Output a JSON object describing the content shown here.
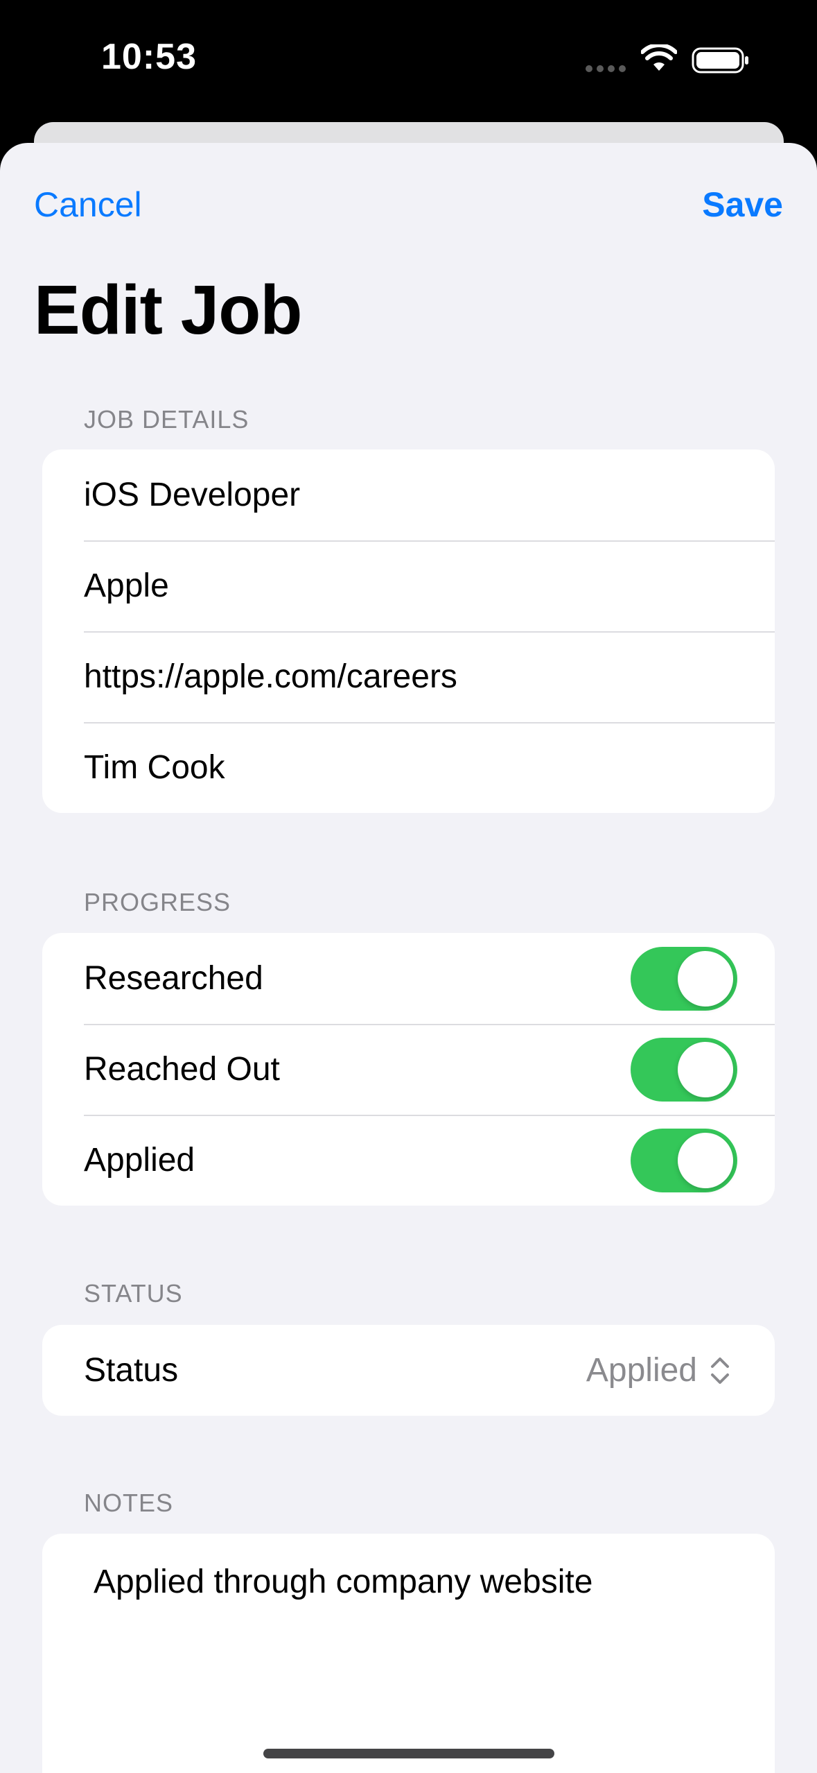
{
  "status_bar": {
    "time": "10:53",
    "wifi_icon": "wifi-icon",
    "battery_icon": "battery-icon"
  },
  "nav": {
    "cancel_label": "Cancel",
    "save_label": "Save",
    "title": "Edit Job"
  },
  "job_details": {
    "header": "JOB DETAILS",
    "fields": [
      "iOS Developer",
      "Apple",
      "https://apple.com/careers",
      "Tim Cook"
    ]
  },
  "progress": {
    "header": "PROGRESS",
    "items": [
      {
        "label": "Researched",
        "on": true
      },
      {
        "label": "Reached Out",
        "on": true
      },
      {
        "label": "Applied",
        "on": true
      }
    ]
  },
  "status": {
    "header": "STATUS",
    "label": "Status",
    "value": "Applied",
    "icon": "chevron-up-down-icon"
  },
  "notes": {
    "header": "NOTES",
    "text": "Applied through company website"
  },
  "colors": {
    "accent": "#0a7aff",
    "toggle_on": "#34c759",
    "background": "#f2f2f7"
  }
}
